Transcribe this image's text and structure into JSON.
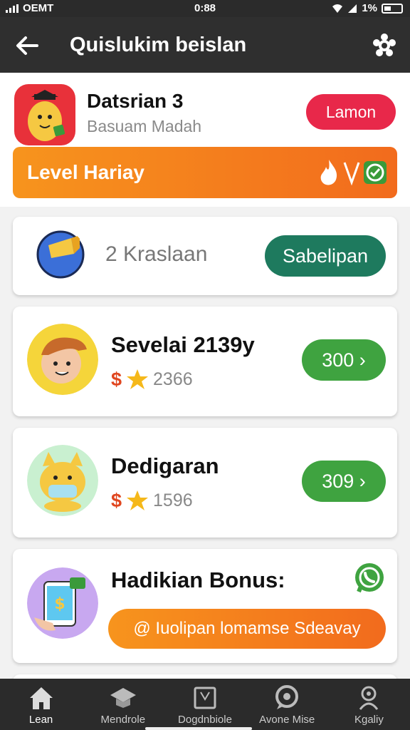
{
  "status_bar": {
    "carrier": "OEMT",
    "time": "0:88",
    "battery": "1%"
  },
  "app_bar": {
    "title": "Quislukim beislan",
    "back_icon": "arrow-left-icon",
    "settings_icon": "gear-icon"
  },
  "header": {
    "name": "Datsrian  3",
    "subtitle": "Basuam Madah",
    "action_label": "Lamon",
    "level_label": "Level Hariay"
  },
  "cards": [
    {
      "title": "2 Kraslaan",
      "button": "Sabelipan"
    },
    {
      "title": "Sevelai 2139y",
      "points": "2366",
      "button": "300 ›"
    },
    {
      "title": "Dedigaran",
      "points": "1596",
      "button": "309 ›"
    },
    {
      "title": "Hadikian Bonus:",
      "button": "@  Iuolipan lomamse Sdeavay"
    }
  ],
  "currency_symbol": "$",
  "nav": [
    {
      "label": "Lean",
      "icon": "home-icon"
    },
    {
      "label": "Mendrole",
      "icon": "graduation-cap-icon"
    },
    {
      "label": "Dogdnbiole",
      "icon": "book-icon"
    },
    {
      "label": "Avone Mise",
      "icon": "chat-icon"
    },
    {
      "label": "Kgaliy",
      "icon": "person-icon"
    }
  ],
  "colors": {
    "accent_orange": "#f26b1d",
    "accent_red": "#e8284a",
    "green": "#3fa340",
    "teal": "#1e7a5e"
  }
}
